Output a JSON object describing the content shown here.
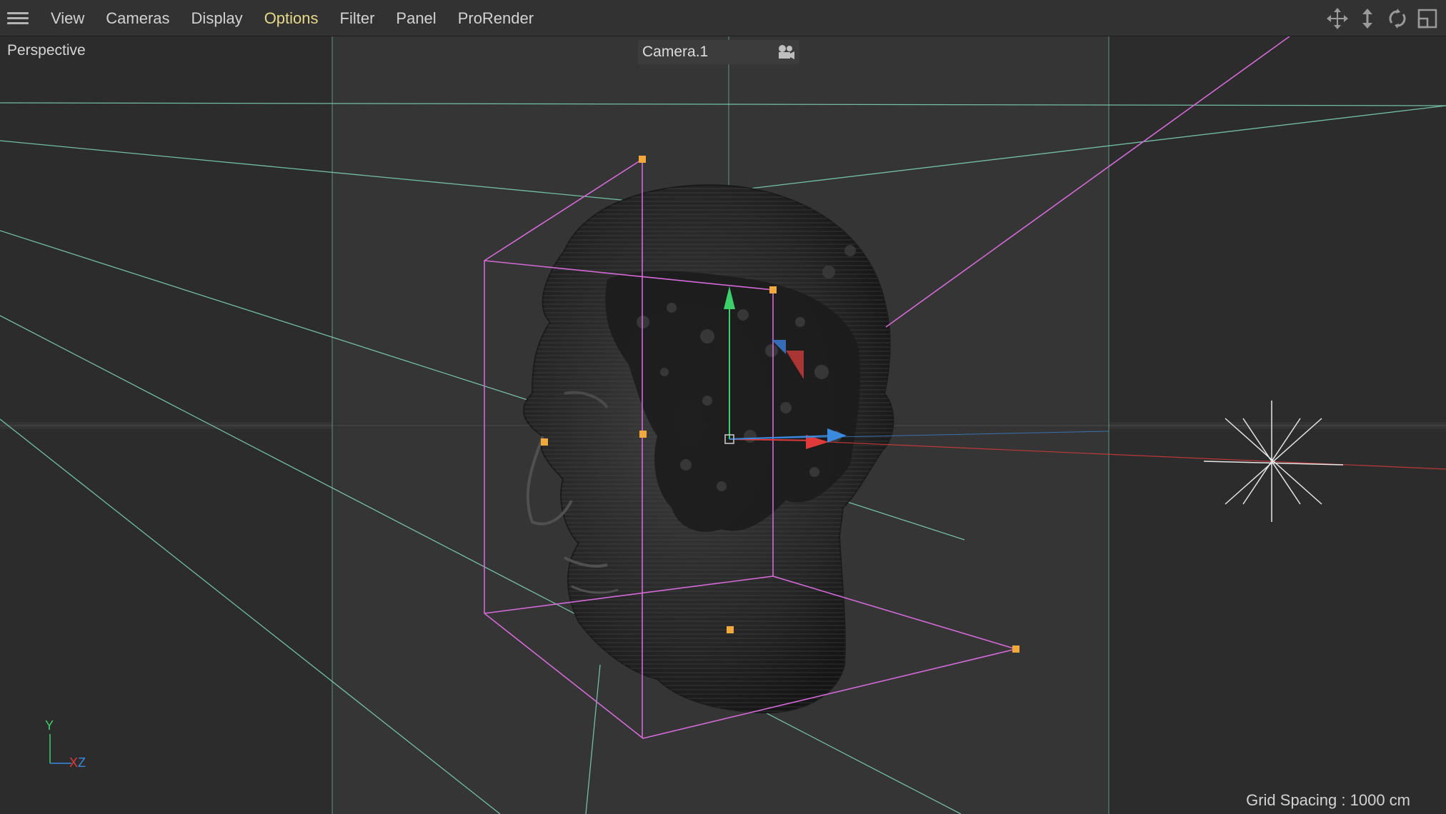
{
  "menubar": {
    "items": [
      {
        "label": "View"
      },
      {
        "label": "Cameras"
      },
      {
        "label": "Display"
      },
      {
        "label": "Options"
      },
      {
        "label": "Filter"
      },
      {
        "label": "Panel"
      },
      {
        "label": "ProRender"
      }
    ],
    "active_item": "Options",
    "toolbar_icons": [
      "move-view-icon",
      "zoom-view-icon",
      "rotate-view-icon",
      "maximize-view-icon"
    ]
  },
  "viewport": {
    "label": "Perspective",
    "camera": {
      "name": "Camera.1",
      "icon": "camera-icon"
    },
    "grid_spacing": "Grid Spacing : 1000 cm",
    "axis": {
      "y": "Y",
      "x": "X",
      "z": "Z"
    },
    "colors": {
      "background": "#2e2e2e",
      "safe_frame": "#3a3a3a",
      "camera_lines": "#7fd6b8",
      "bounding_box": "#d46ad8",
      "handles": "#f2a93b",
      "axis_x": "#e03a3a",
      "axis_y": "#3ccf6a",
      "axis_z": "#3a8ae0"
    }
  }
}
